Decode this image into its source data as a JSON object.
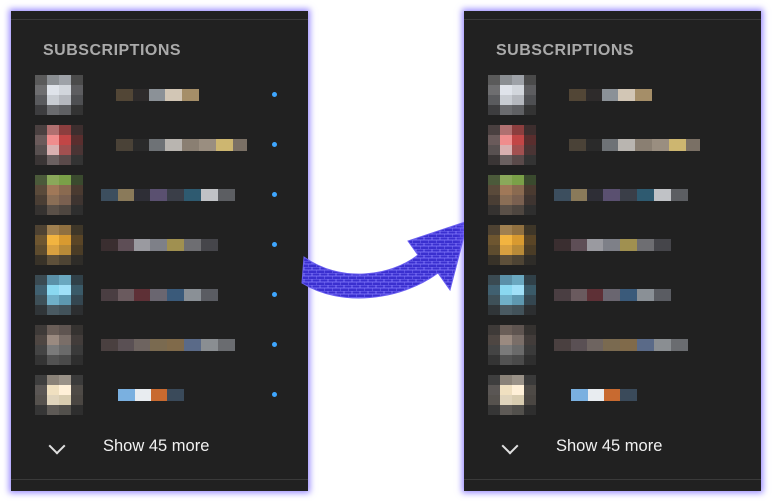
{
  "sidebar_left": {
    "title": "SUBSCRIPTIONS",
    "show_more_label": "Show 45 more",
    "items": [
      {
        "name": "",
        "has_new": true
      },
      {
        "name": "",
        "has_new": true
      },
      {
        "name": "",
        "has_new": true
      },
      {
        "name": "",
        "has_new": true
      },
      {
        "name": "",
        "has_new": true
      },
      {
        "name": "",
        "has_new": true
      },
      {
        "name": "",
        "has_new": true
      }
    ]
  },
  "sidebar_right": {
    "title": "SUBSCRIPTIONS",
    "show_more_label": "Show 45 more",
    "items": [
      {
        "name": "",
        "has_new": false
      },
      {
        "name": "",
        "has_new": false
      },
      {
        "name": "",
        "has_new": false
      },
      {
        "name": "",
        "has_new": false
      },
      {
        "name": "",
        "has_new": false
      },
      {
        "name": "",
        "has_new": false
      },
      {
        "name": "",
        "has_new": false
      }
    ]
  },
  "colors": {
    "panel_bg": "#212121",
    "title_color": "#aaaaaa",
    "new_dot": "#3ea6ff",
    "arrow_fill": "#4a3fd8",
    "glow": "#7864ff"
  },
  "icons": {
    "expand": "chevron-down-icon",
    "transition": "arrow-right-icon"
  }
}
